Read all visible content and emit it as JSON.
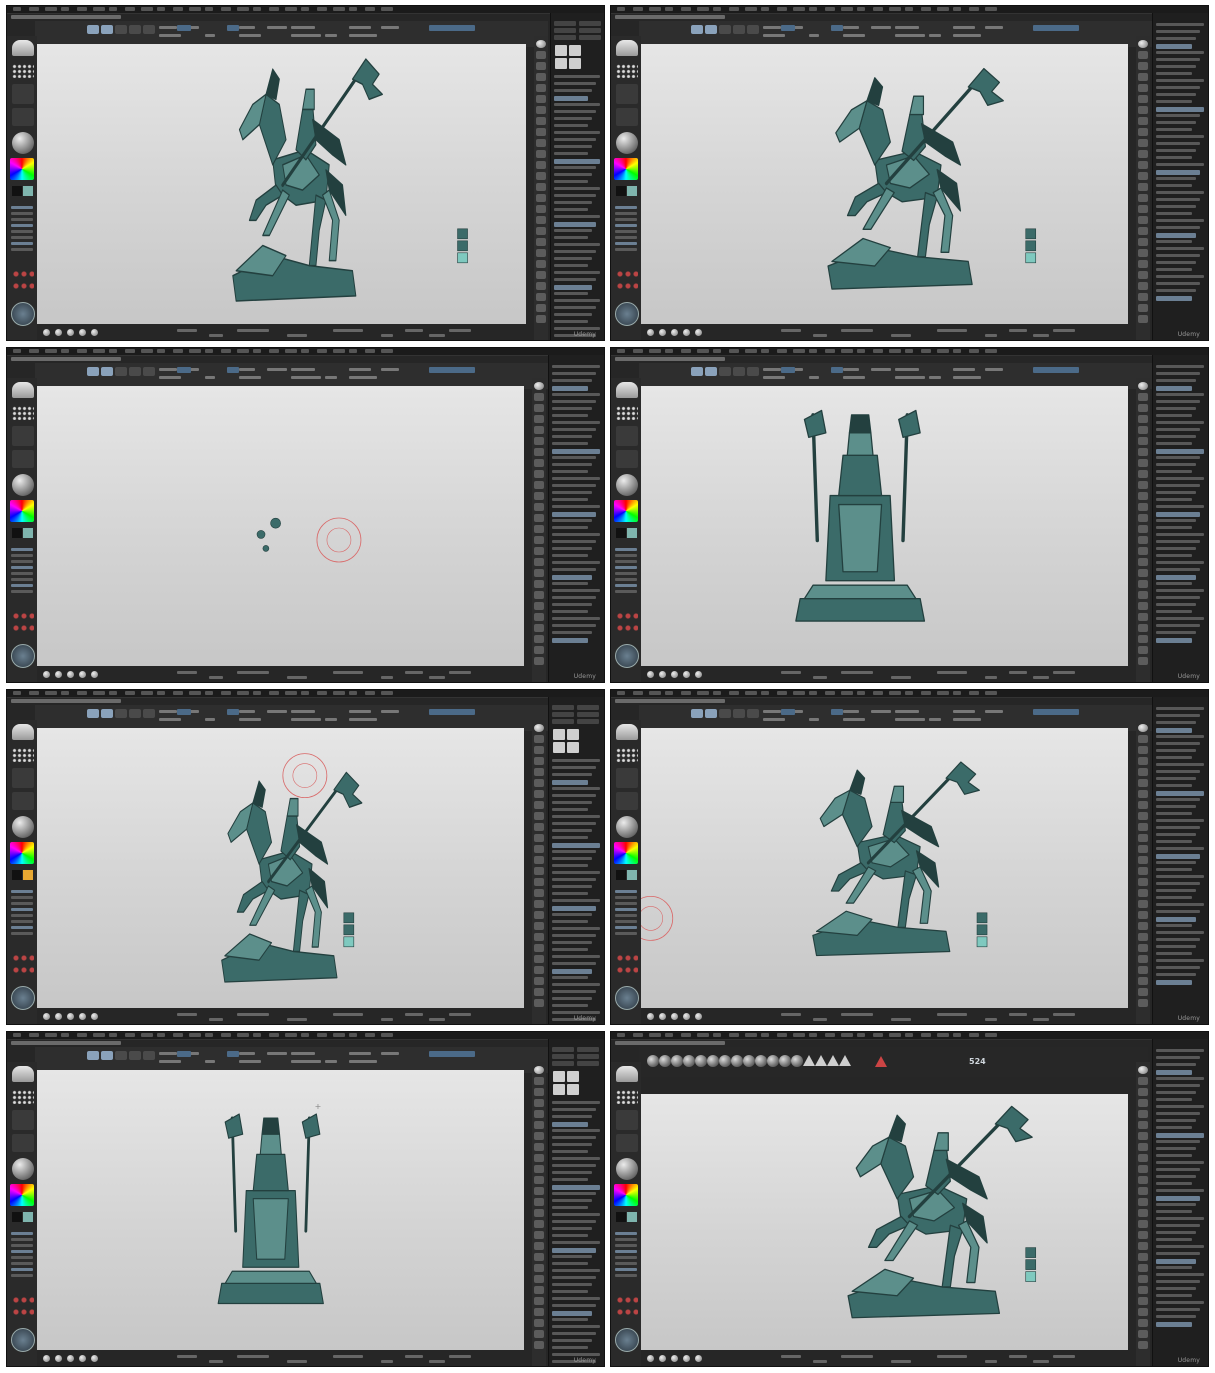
{
  "watermark": "Udemy",
  "frames": [
    {
      "id": "frame-1",
      "view": "side-rider-flag",
      "tray": "tool-menu"
    },
    {
      "id": "frame-2",
      "view": "side-rider-flag",
      "tray": "subtool-list"
    },
    {
      "id": "frame-3",
      "view": "empty-canvas-spheres",
      "tray": "subtool-list"
    },
    {
      "id": "frame-4",
      "view": "back-view",
      "tray": "subtool-list"
    },
    {
      "id": "frame-5",
      "view": "side-rider-flag",
      "tray": "subtool-list"
    },
    {
      "id": "frame-6",
      "view": "side-rider-flag",
      "tray": "subtool-list"
    },
    {
      "id": "frame-7",
      "view": "front-view",
      "tray": "subtool-list"
    },
    {
      "id": "frame-8",
      "view": "side-rider-flag",
      "tray": "brush-palette",
      "brush_size": "524"
    }
  ],
  "colors": {
    "model": "#3b6b69",
    "model_light": "#5c8f8b",
    "model_dark": "#23403f",
    "ui_dark": "#262626",
    "cursor_ring": "#d96a6a",
    "highlight": "#8aa2bb"
  }
}
